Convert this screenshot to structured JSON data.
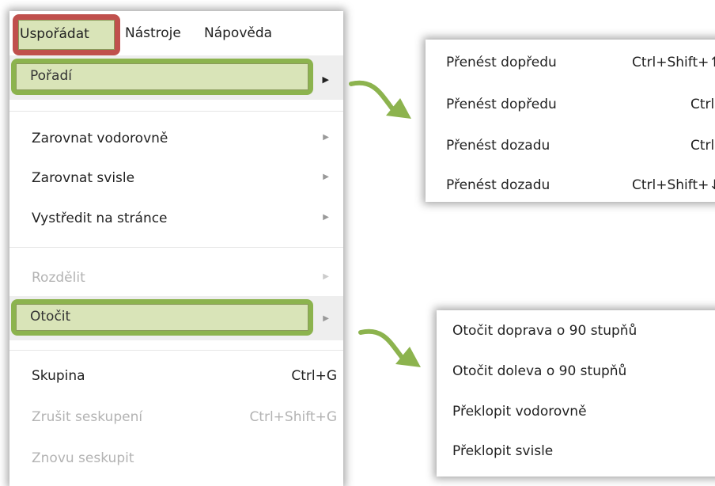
{
  "menubar": {
    "items": [
      "Uspořádat",
      "Nástroje",
      "Nápověda"
    ]
  },
  "arrange_menu": {
    "order_label": "Pořadí",
    "align_h_label": "Zarovnat vodorovně",
    "align_v_label": "Zarovnat svisle",
    "center_label": "Vystředit na stránce",
    "distribute_label": "Rozdělit",
    "rotate_label": "Otočit",
    "group_label": "Skupina",
    "group_shortcut": "Ctrl+G",
    "ungroup_label": "Zrušit seskupení",
    "ungroup_shortcut": "Ctrl+Shift+G",
    "regroup_label": "Znovu seskupit"
  },
  "order_submenu": [
    {
      "label": "Přenést dopředu",
      "shortcut": "Ctrl+Shift+↑"
    },
    {
      "label": "Přenést dopředu",
      "shortcut": "Ctrl+↑"
    },
    {
      "label": "Přenést dozadu",
      "shortcut": "Ctrl+↓"
    },
    {
      "label": "Přenést dozadu",
      "shortcut": "Ctrl+Shift+↓"
    }
  ],
  "rotate_submenu": [
    {
      "label": "Otočit doprava o 90 stupňů"
    },
    {
      "label": "Otočit doleva o 90 stupňů"
    },
    {
      "label": "Překlopit vodorovně"
    },
    {
      "label": "Překlopit svisle"
    }
  ],
  "colors": {
    "highlight_green": "#8cb34e",
    "highlight_red": "#c0504d",
    "arrow_green": "#8cb34e"
  }
}
